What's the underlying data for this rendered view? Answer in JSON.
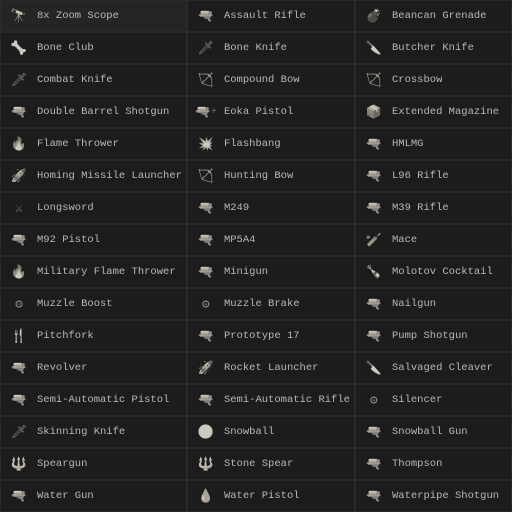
{
  "items": [
    {
      "label": "8x Zoom Scope",
      "icon": "🔭",
      "iconClass": "icon-item"
    },
    {
      "label": "Assault Rifle",
      "icon": "🔫",
      "iconClass": "icon-rifle"
    },
    {
      "label": "Beancan Grenade",
      "icon": "💣",
      "iconClass": "icon-grenade"
    },
    {
      "label": "Bone Club",
      "icon": "🦴",
      "iconClass": "icon-melee"
    },
    {
      "label": "Bone Knife",
      "icon": "🗡",
      "iconClass": "icon-knife"
    },
    {
      "label": "Butcher Knife",
      "icon": "🔪",
      "iconClass": "icon-knife"
    },
    {
      "label": "Combat Knife",
      "icon": "🗡",
      "iconClass": "icon-knife"
    },
    {
      "label": "Compound Bow",
      "icon": "🏹",
      "iconClass": "icon-bow"
    },
    {
      "label": "Crossbow",
      "icon": "🏹",
      "iconClass": "icon-bow"
    },
    {
      "label": "Double Barrel Shotgun",
      "icon": "🔫",
      "iconClass": "icon-gun"
    },
    {
      "label": "Eoka Pistol",
      "icon": "🔫",
      "iconClass": "icon-gun",
      "badge": "+"
    },
    {
      "label": "Extended Magazine",
      "icon": "📦",
      "iconClass": "icon-item"
    },
    {
      "label": "Flame Thrower",
      "icon": "🔥",
      "iconClass": "icon-launcher"
    },
    {
      "label": "Flashbang",
      "icon": "💥",
      "iconClass": "icon-grenade"
    },
    {
      "label": "HMLMG",
      "icon": "🔫",
      "iconClass": "icon-rifle"
    },
    {
      "label": "Homing Missile Launcher",
      "icon": "🚀",
      "iconClass": "icon-launcher"
    },
    {
      "label": "Hunting Bow",
      "icon": "🏹",
      "iconClass": "icon-bow"
    },
    {
      "label": "L96 Rifle",
      "icon": "🔫",
      "iconClass": "icon-rifle"
    },
    {
      "label": "Longsword",
      "icon": "⚔",
      "iconClass": "icon-melee"
    },
    {
      "label": "M249",
      "icon": "🔫",
      "iconClass": "icon-rifle"
    },
    {
      "label": "M39 Rifle",
      "icon": "🔫",
      "iconClass": "icon-rifle"
    },
    {
      "label": "M92 Pistol",
      "icon": "🔫",
      "iconClass": "icon-gun"
    },
    {
      "label": "MP5A4",
      "icon": "🔫",
      "iconClass": "icon-rifle"
    },
    {
      "label": "Mace",
      "icon": "🏏",
      "iconClass": "icon-melee"
    },
    {
      "label": "Military Flame Thrower",
      "icon": "🔥",
      "iconClass": "icon-launcher"
    },
    {
      "label": "Minigun",
      "icon": "🔫",
      "iconClass": "icon-rifle"
    },
    {
      "label": "Molotov Cocktail",
      "icon": "🍾",
      "iconClass": "icon-grenade"
    },
    {
      "label": "Muzzle Boost",
      "icon": "⚙",
      "iconClass": "icon-item"
    },
    {
      "label": "Muzzle Brake",
      "icon": "⚙",
      "iconClass": "icon-item"
    },
    {
      "label": "Nailgun",
      "icon": "🔫",
      "iconClass": "icon-gun"
    },
    {
      "label": "Pitchfork",
      "icon": "🍴",
      "iconClass": "icon-melee"
    },
    {
      "label": "Prototype 17",
      "icon": "🔫",
      "iconClass": "icon-gun"
    },
    {
      "label": "Pump Shotgun",
      "icon": "🔫",
      "iconClass": "icon-gun"
    },
    {
      "label": "Revolver",
      "icon": "🔫",
      "iconClass": "icon-gun"
    },
    {
      "label": "Rocket Launcher",
      "icon": "🚀",
      "iconClass": "icon-launcher"
    },
    {
      "label": "Salvaged Cleaver",
      "icon": "🔪",
      "iconClass": "icon-knife"
    },
    {
      "label": "Semi-Automatic Pistol",
      "icon": "🔫",
      "iconClass": "icon-gun"
    },
    {
      "label": "Semi-Automatic Rifle",
      "icon": "🔫",
      "iconClass": "icon-rifle"
    },
    {
      "label": "Silencer",
      "icon": "⚙",
      "iconClass": "icon-item"
    },
    {
      "label": "Skinning Knife",
      "icon": "🗡",
      "iconClass": "icon-knife"
    },
    {
      "label": "Snowball",
      "icon": "⚪",
      "iconClass": "icon-item"
    },
    {
      "label": "Snowball Gun",
      "icon": "🔫",
      "iconClass": "icon-gun"
    },
    {
      "label": "Speargun",
      "icon": "🔱",
      "iconClass": "icon-launcher"
    },
    {
      "label": "Stone Spear",
      "icon": "🔱",
      "iconClass": "icon-melee"
    },
    {
      "label": "Thompson",
      "icon": "🔫",
      "iconClass": "icon-rifle"
    },
    {
      "label": "Water Gun",
      "icon": "🔫",
      "iconClass": "icon-gun"
    },
    {
      "label": "Water Pistol",
      "icon": "💧",
      "iconClass": "icon-gun"
    },
    {
      "label": "Waterpipe Shotgun",
      "icon": "🔫",
      "iconClass": "icon-gun"
    }
  ]
}
